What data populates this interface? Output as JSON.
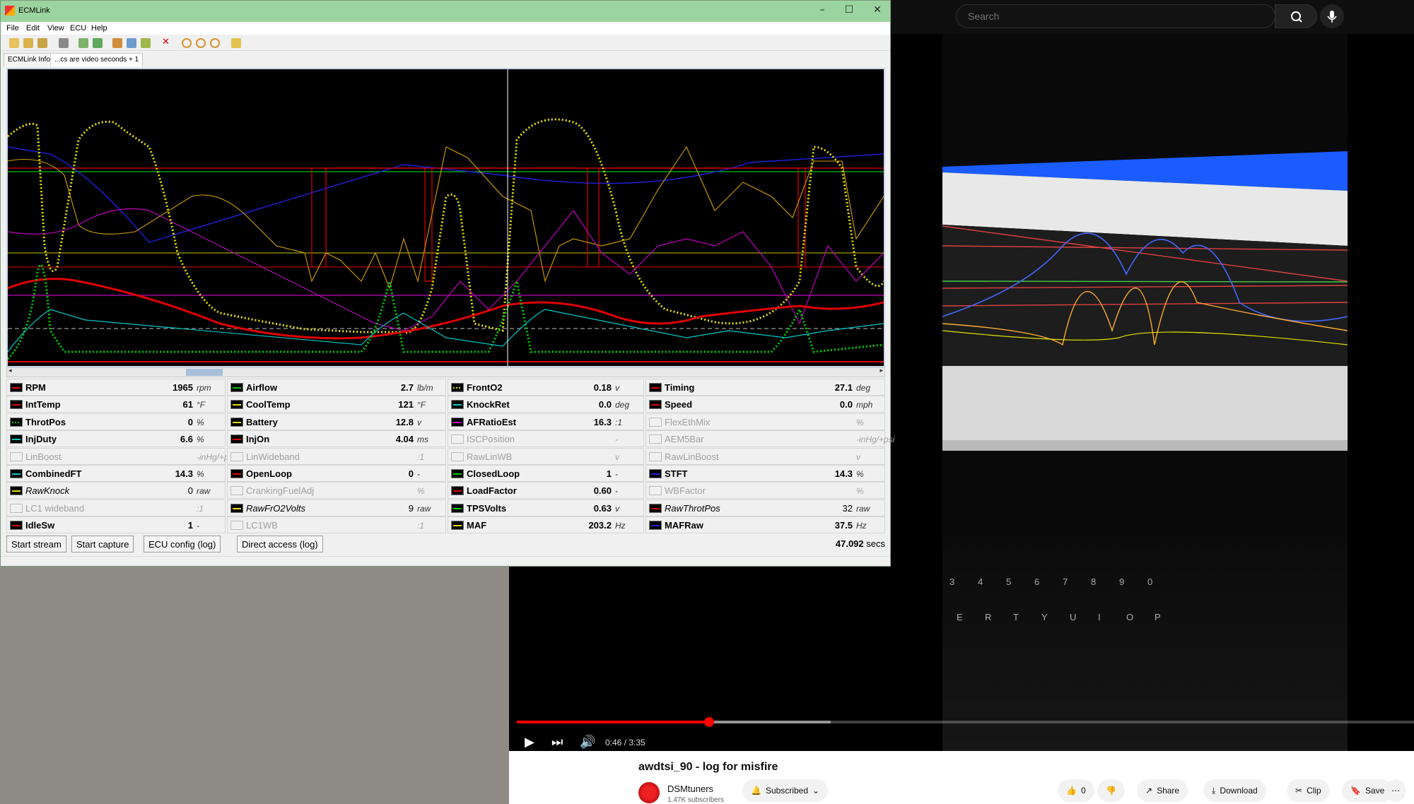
{
  "ecmlink": {
    "window_title": "ECMLink",
    "menu": [
      "File",
      "Edit",
      "View",
      "ECU",
      "Help"
    ],
    "tabs": [
      "ECMLink Info",
      "...cs are video seconds + 1"
    ],
    "params": [
      [
        {
          "name": "RPM",
          "value": "1965",
          "unit": "rpm",
          "color": "#e00000"
        },
        {
          "name": "IntTemp",
          "value": "61",
          "unit": "°F",
          "color": "#e00000"
        },
        {
          "name": "ThrotPos",
          "value": "0",
          "unit": "%",
          "color": "#00d000",
          "dotted": true
        },
        {
          "name": "InjDuty",
          "value": "6.6",
          "unit": "%",
          "color": "#00c8c8"
        },
        {
          "name": "LinBoost",
          "value": "",
          "unit": "-inHg/+psi",
          "disabled": true
        },
        {
          "name": "CombinedFT",
          "value": "14.3",
          "unit": "%",
          "color": "#00c8c8"
        },
        {
          "name": "RawKnock",
          "value": "0",
          "unit": "raw",
          "color": "#e8e000",
          "italic": true
        },
        {
          "name": "LC1 wideband",
          "value": "",
          "unit": ":1",
          "disabled": true
        },
        {
          "name": "IdleSw",
          "value": "1",
          "unit": "-",
          "color": "#e00000"
        }
      ],
      [
        {
          "name": "Airflow",
          "value": "2.7",
          "unit": "lb/m",
          "color": "#00c000"
        },
        {
          "name": "CoolTemp",
          "value": "121",
          "unit": "°F",
          "color": "#e8e000"
        },
        {
          "name": "Battery",
          "value": "12.8",
          "unit": "v",
          "color": "#e8e000"
        },
        {
          "name": "InjOn",
          "value": "4.04",
          "unit": "ms",
          "color": "#e00000"
        },
        {
          "name": "LinWideband",
          "value": "",
          "unit": ":1",
          "disabled": true
        },
        {
          "name": "OpenLoop",
          "value": "0",
          "unit": "-",
          "color": "#e00000"
        },
        {
          "name": "CrankingFuelAdj",
          "value": "",
          "unit": "%",
          "disabled": true
        },
        {
          "name": "RawFrO2Volts",
          "value": "9",
          "unit": "raw",
          "color": "#e8e000",
          "italic": true
        },
        {
          "name": "LC1WB",
          "value": "",
          "unit": ":1",
          "disabled": true
        }
      ],
      [
        {
          "name": "FrontO2",
          "value": "0.18",
          "unit": "v",
          "color": "#e8e000",
          "dotted": true
        },
        {
          "name": "KnockRet",
          "value": "0.0",
          "unit": "deg",
          "color": "#00c8c8"
        },
        {
          "name": "AFRatioEst",
          "value": "16.3",
          "unit": ":1",
          "color": "#c000c0"
        },
        {
          "name": "ISCPosition",
          "value": "",
          "unit": "-",
          "disabled": true
        },
        {
          "name": "RawLinWB",
          "value": "",
          "unit": "v",
          "disabled": true
        },
        {
          "name": "ClosedLoop",
          "value": "1",
          "unit": "-",
          "color": "#00c000"
        },
        {
          "name": "LoadFactor",
          "value": "0.60",
          "unit": "-",
          "color": "#e00000"
        },
        {
          "name": "TPSVolts",
          "value": "0.63",
          "unit": "v",
          "color": "#00c000"
        },
        {
          "name": "MAF",
          "value": "203.2",
          "unit": "Hz",
          "color": "#e8e000"
        }
      ],
      [
        {
          "name": "Timing",
          "value": "27.1",
          "unit": "deg",
          "color": "#e00000"
        },
        {
          "name": "Speed",
          "value": "0.0",
          "unit": "mph",
          "color": "#e00000"
        },
        {
          "name": "FlexEthMix",
          "value": "",
          "unit": "%",
          "disabled": true
        },
        {
          "name": "AEM5Bar",
          "value": "",
          "unit": "-inHg/+psi",
          "disabled": true
        },
        {
          "name": "RawLinBoost",
          "value": "",
          "unit": "v",
          "disabled": true
        },
        {
          "name": "STFT",
          "value": "14.3",
          "unit": "%",
          "color": "#2020e0"
        },
        {
          "name": "WBFactor",
          "value": "",
          "unit": "%",
          "disabled": true
        },
        {
          "name": "RawThrotPos",
          "value": "32",
          "unit": "raw",
          "color": "#e00000",
          "italic": true
        },
        {
          "name": "MAFRaw",
          "value": "37.5",
          "unit": "Hz",
          "color": "#2020e0"
        }
      ]
    ],
    "buttons": {
      "start_stream": "Start stream",
      "start_capture": "Start capture",
      "ecu_config": "ECU config (log)",
      "direct_access": "Direct access (log)"
    },
    "elapsed": "47.092",
    "elapsed_unit": "secs"
  },
  "youtube": {
    "search_placeholder": "Search",
    "time_readout": "0:46 / 3:35",
    "progress_fraction": 0.214,
    "video_title": "awdtsi_90 - log for misfire",
    "channel": "DSMtuners",
    "subscribers": "1.47K subscribers",
    "subscribed_label": "Subscribed",
    "like_count": "0",
    "share_label": "Share",
    "download_label": "Download",
    "clip_label": "Clip",
    "save_label": "Save"
  }
}
